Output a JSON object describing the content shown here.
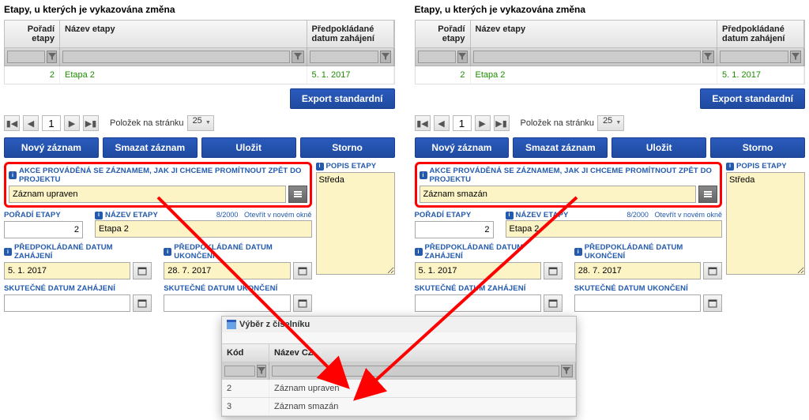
{
  "panels": {
    "A": {
      "title": "Etapy, u kterých je vykazována změna",
      "gridHeaders": {
        "c1": "Pořadí etapy",
        "c2": "Název etapy",
        "c3": "Předpokládané datum zahájení"
      },
      "row": {
        "c1": "2",
        "c2": "Etapa 2",
        "c3": "5. 1. 2017"
      },
      "exportBtn": "Export standardní",
      "pagerLabel": "Položek na stránku",
      "pagerPage": "1",
      "pagerSize": "25",
      "actions": {
        "new": "Nový záznam",
        "del": "Smazat záznam",
        "save": "Uložit",
        "cancel": "Storno"
      },
      "form": {
        "akceLabel": "AKCE PROVÁDĚNÁ SE ZÁZNAMEM, JAK JI CHCEME PROMÍTNOUT ZPĚT DO PROJEKTU",
        "akceValue": "Záznam upraven",
        "poradLabel": "POŘADÍ ETAPY",
        "poradValue": "2",
        "nazevLabel": "NÁZEV ETAPY",
        "nazevValue": "Etapa 2",
        "subCount": "8/2000",
        "subLink": "Otevřít v novém okně",
        "datZahLbl": "PŘEDPOKLÁDANÉ DATUM ZAHÁJENÍ",
        "datZahVal": "5. 1. 2017",
        "datUkLbl": "PŘEDPOKLÁDANÉ DATUM UKONČENÍ",
        "datUkVal": "28. 7. 2017",
        "skZahLbl": "SKUTEČNÉ DATUM ZAHÁJENÍ",
        "skUkLbl": "SKUTEČNÉ DATUM UKONČENÍ",
        "popisLbl": "POPIS ETAPY",
        "popisVal": "Středa"
      }
    },
    "B": {
      "form": {
        "akceValue": "Záznam smazán"
      }
    }
  },
  "popup": {
    "title": "Výběr z číselníku",
    "headers": {
      "c1": "Kód",
      "c2": "Název CZ"
    },
    "rows": [
      {
        "c1": "2",
        "c2": "Záznam upraven"
      },
      {
        "c1": "3",
        "c2": "Záznam smazán"
      }
    ]
  }
}
